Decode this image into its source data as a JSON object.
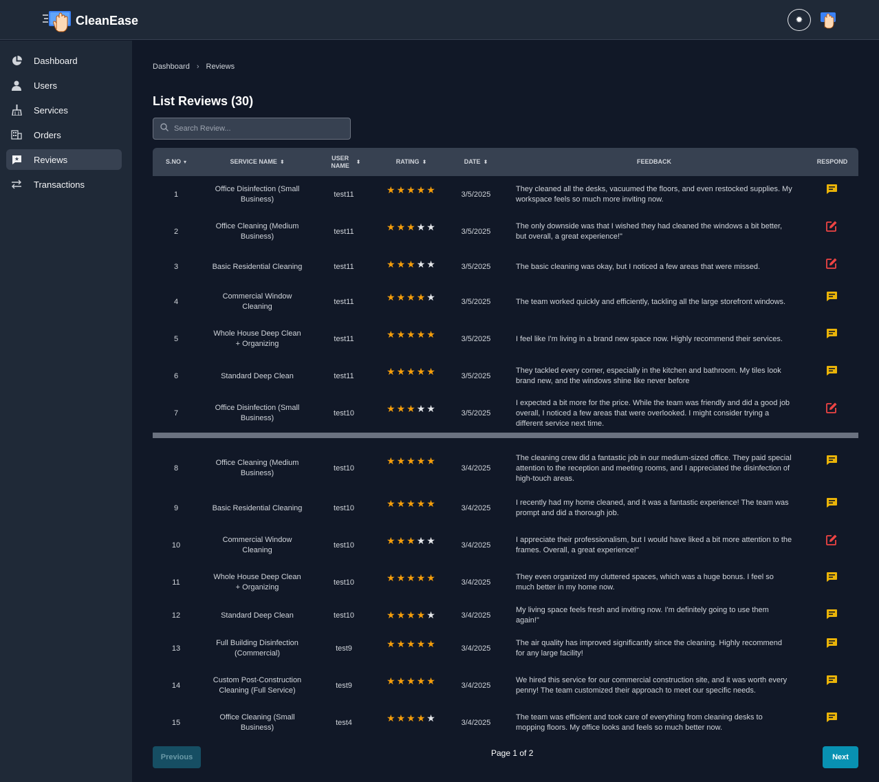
{
  "app": {
    "name": "CleanEase",
    "theme_toggle_icon": "sun-icon"
  },
  "sidebar": {
    "items": [
      {
        "label": "Dashboard",
        "icon": "pie-chart-icon",
        "active": false
      },
      {
        "label": "Users",
        "icon": "user-icon",
        "active": false
      },
      {
        "label": "Services",
        "icon": "broom-icon",
        "active": false
      },
      {
        "label": "Orders",
        "icon": "building-icon",
        "active": false
      },
      {
        "label": "Reviews",
        "icon": "review-icon",
        "active": true
      },
      {
        "label": "Transactions",
        "icon": "arrows-exchange-icon",
        "active": false
      }
    ]
  },
  "breadcrumb": {
    "root": "Dashboard",
    "current": "Reviews"
  },
  "page": {
    "title": "List Reviews (30)"
  },
  "search": {
    "placeholder": "Search Review..."
  },
  "table": {
    "headers": {
      "sno": "S.NO",
      "service": "SERVICE NAME",
      "user": "USER NAME",
      "rating": "RATING",
      "date": "DATE",
      "feedback": "FEEDBACK",
      "respond": "RESPOND"
    },
    "rows": [
      {
        "sno": "1",
        "service": "Office Disinfection (Small Business)",
        "user": "test11",
        "rating": 5,
        "date": "3/5/2025",
        "feedback": "They cleaned all the desks, vacuumed the floors, and even restocked supplies. My workspace feels so much more inviting now.",
        "respond": "message"
      },
      {
        "sno": "2",
        "service": "Office Cleaning (Medium Business)",
        "user": "test11",
        "rating": 3,
        "date": "3/5/2025",
        "feedback": "The only downside was that I wished they had cleaned the windows a bit better, but overall, a great experience!\"",
        "respond": "edit"
      },
      {
        "sno": "3",
        "service": "Basic Residential Cleaning",
        "user": "test11",
        "rating": 3,
        "date": "3/5/2025",
        "feedback": "The basic cleaning was okay, but I noticed a few areas that were missed.",
        "respond": "edit"
      },
      {
        "sno": "4",
        "service": "Commercial Window Cleaning",
        "user": "test11",
        "rating": 4,
        "date": "3/5/2025",
        "feedback": "The team worked quickly and efficiently, tackling all the large storefront windows.",
        "respond": "message"
      },
      {
        "sno": "5",
        "service": "Whole House Deep Clean + Organizing",
        "user": "test11",
        "rating": 5,
        "date": "3/5/2025",
        "feedback": "I feel like I'm living in a brand new space now. Highly recommend their services.",
        "respond": "message"
      },
      {
        "sno": "6",
        "service": "Standard Deep Clean",
        "user": "test11",
        "rating": 5,
        "date": "3/5/2025",
        "feedback": "They tackled every corner, especially in the kitchen and bathroom. My tiles look brand new, and the windows shine like never before",
        "respond": "message"
      },
      {
        "sno": "7",
        "service": "Office Disinfection (Small Business)",
        "user": "test10",
        "rating": 3,
        "date": "3/5/2025",
        "feedback": "I expected a bit more for the price. While the team was friendly and did a good job overall, I noticed a few areas that were overlooked. I might consider trying a different service next time.",
        "respond": "edit"
      },
      {
        "sno": "8",
        "service": "Office Cleaning (Medium Business)",
        "user": "test10",
        "rating": 5,
        "date": "3/4/2025",
        "feedback": "The cleaning crew did a fantastic job in our medium-sized office. They paid special attention to the reception and meeting rooms, and I appreciated the disinfection of high-touch areas.",
        "respond": "message"
      },
      {
        "sno": "9",
        "service": "Basic Residential Cleaning",
        "user": "test10",
        "rating": 5,
        "date": "3/4/2025",
        "feedback": "I recently had my home cleaned, and it was a fantastic experience! The team was prompt and did a thorough job.",
        "respond": "message"
      },
      {
        "sno": "10",
        "service": "Commercial Window Cleaning",
        "user": "test10",
        "rating": 3,
        "date": "3/4/2025",
        "feedback": "I appreciate their professionalism, but I would have liked a bit more attention to the frames. Overall, a great experience!\"",
        "respond": "edit"
      },
      {
        "sno": "11",
        "service": "Whole House Deep Clean + Organizing",
        "user": "test10",
        "rating": 5,
        "date": "3/4/2025",
        "feedback": "They even organized my cluttered spaces, which was a huge bonus. I feel so much better in my home now.",
        "respond": "message"
      },
      {
        "sno": "12",
        "service": "Standard Deep Clean",
        "user": "test10",
        "rating": 4,
        "date": "3/4/2025",
        "feedback": "My living space feels fresh and inviting now. I'm definitely going to use them again!\"",
        "respond": "message"
      },
      {
        "sno": "13",
        "service": "Full Building Disinfection (Commercial)",
        "user": "test9",
        "rating": 5,
        "date": "3/4/2025",
        "feedback": "The air quality has improved significantly since the cleaning. Highly recommend for any large facility!",
        "respond": "message"
      },
      {
        "sno": "14",
        "service": "Custom Post-Construction Cleaning (Full Service)",
        "user": "test9",
        "rating": 5,
        "date": "3/4/2025",
        "feedback": "We hired this service for our commercial construction site, and it was worth every penny! The team customized their approach to meet our specific needs.",
        "respond": "message"
      },
      {
        "sno": "15",
        "service": "Office Cleaning (Small Business)",
        "user": "test4",
        "rating": 4,
        "date": "3/4/2025",
        "feedback": "The team was efficient and took care of everything from cleaning desks to mopping floors. My office looks and feels so much better now.",
        "respond": "message"
      }
    ]
  },
  "pagination": {
    "previous": "Previous",
    "next": "Next",
    "status": "Page 1 of 2"
  },
  "colors": {
    "star_on": "#f59e0b",
    "star_off": "#e5e7eb",
    "message_icon": "#eab308",
    "edit_icon": "#ef4444",
    "accent": "#0891b2"
  }
}
